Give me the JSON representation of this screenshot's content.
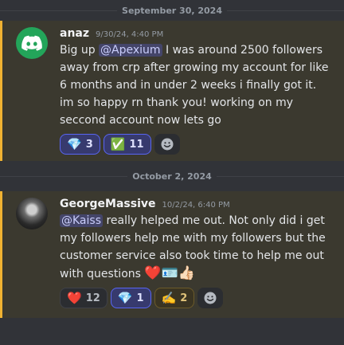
{
  "dividers": [
    "September 30, 2024",
    "October 2, 2024"
  ],
  "messages": [
    {
      "username": "anaz",
      "timestamp": "9/30/24, 4:40 PM",
      "mention": "@Apexium",
      "pre_mention": "Big up ",
      "text": " I was around 2500 followers away from crp after growing my account for like 6 months and in under 2 weeks i finally got it. im so happy rn thank you! working on my seccond account now lets go",
      "reactions": [
        {
          "emoji": "💎",
          "icon": "gem-icon",
          "count": "3"
        },
        {
          "emoji": "✅",
          "icon": "check-mark-icon",
          "count": "11"
        }
      ]
    },
    {
      "username": "GeorgeMassive",
      "timestamp": "10/2/24, 6:40 PM",
      "mention": "@Kaiss",
      "text": " really helped me out. Not only did i get my followers help me with my followers but the customer service also took time to help me out with questions",
      "inline_emojis": [
        "❤️",
        "🪪",
        "👍🏻"
      ],
      "reactions": [
        {
          "emoji": "❤️",
          "icon": "heart-icon",
          "count": "12"
        },
        {
          "emoji": "💎",
          "icon": "gem-icon",
          "count": "1"
        },
        {
          "emoji": "✍️",
          "icon": "writing-hand-icon",
          "count": "2"
        }
      ]
    }
  ],
  "colors": {
    "highlight_bg": "#3b392f",
    "highlight_border": "#f0b232",
    "mention_text": "#c9cdfb",
    "discord_green": "#23a55a"
  }
}
